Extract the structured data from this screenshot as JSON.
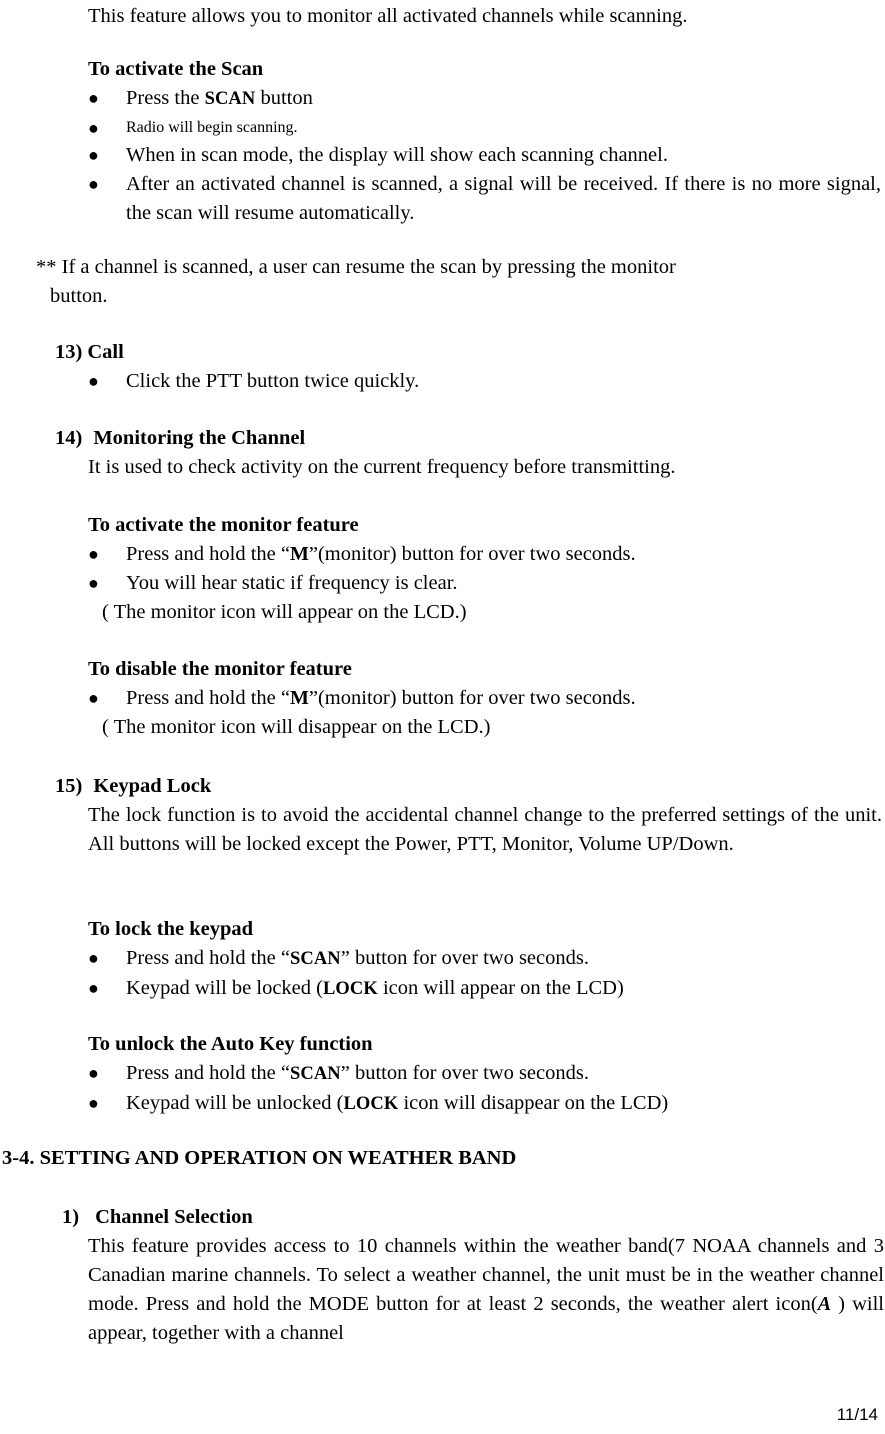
{
  "document": {
    "page_number": "11/14"
  },
  "intro": {
    "text": "This feature allows you to monitor all activated channels while scanning."
  },
  "scan_section": {
    "heading": "To activate the Scan",
    "bullets": [
      {
        "pre": "Press the ",
        "keycap": "SCAN",
        "post": " button",
        "small": false
      },
      {
        "pre": "Radio will begin scanning.",
        "keycap": "",
        "post": "",
        "small": true
      },
      {
        "pre": "When in scan mode, the display will show each scanning channel.",
        "keycap": "",
        "post": "",
        "small": false
      },
      {
        "pre": "After an activated channel is scanned, a signal will be received. If there is no more signal, the scan will resume automatically.",
        "keycap": "",
        "post": "",
        "small": false
      }
    ]
  },
  "note": {
    "line1": "** If a channel is scanned, a user can resume the scan by pressing the monitor",
    "line2": "button."
  },
  "item13": {
    "number": "13)",
    "title": "Call",
    "bullets": [
      "Click the PTT button twice quickly."
    ]
  },
  "item14": {
    "number": "14)",
    "title": "Monitoring the Channel",
    "body": "It is used to check activity on the current frequency before transmitting.",
    "activate": {
      "heading": "To activate the monitor feature",
      "bullet1_pre": "Press and hold the “",
      "bullet1_key": "M",
      "bullet1_post": "”(monitor) button for over two seconds.",
      "bullet2": "You will hear static if frequency is clear.",
      "paren": "( The monitor icon will appear on the LCD.)"
    },
    "disable": {
      "heading": "To disable the monitor feature",
      "bullet1_pre": "Press and hold the “",
      "bullet1_key": "M",
      "bullet1_post": "”(monitor) button for over two seconds.",
      "paren": "( The monitor icon will disappear on the LCD.)"
    }
  },
  "item15": {
    "number": "15)",
    "title": "Keypad Lock",
    "body": "The lock function is to avoid the accidental channel change to the preferred settings of the unit. All buttons will be locked except the Power, PTT, Monitor, Volume UP/Down.",
    "lock": {
      "heading": "To lock the keypad",
      "bullet1_pre": "Press and hold the “",
      "bullet1_key": "SCAN",
      "bullet1_post": "” button for over two seconds.",
      "bullet2_pre": "Keypad will be locked (",
      "bullet2_key": "LOCK",
      "bullet2_post": " icon will appear on the LCD)"
    },
    "unlock": {
      "heading": "To unlock the Auto Key function",
      "bullet1_pre": "Press and hold the “",
      "bullet1_key": "SCAN",
      "bullet1_post": "” button for over two seconds.",
      "bullet2_pre": "Keypad will be unlocked (",
      "bullet2_key": "LOCK",
      "bullet2_post": " icon will disappear on the LCD)"
    }
  },
  "section34": {
    "heading": "3-4. SETTING AND OPERATION ON WEATHER BAND",
    "item1": {
      "number": "1)",
      "title": "Channel Selection",
      "body_pre": "This feature provides access to 10 channels within the weather band(7 NOAA channels and 3 Canadian marine channels. To select a weather channel, the unit must be in the weather channel mode. Press and hold the MODE button for at least 2 seconds, the weather alert icon(",
      "body_icon": "A",
      "body_post": " ) will appear, together with a channel"
    }
  },
  "glyphs": {
    "bullet": "●"
  }
}
